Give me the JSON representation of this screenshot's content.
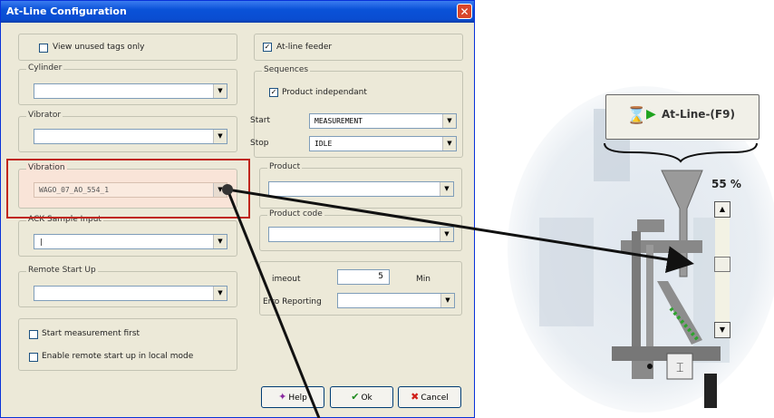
{
  "window": {
    "title": "At-Line Configuration",
    "close_glyph": "✕"
  },
  "left": {
    "view_unused": {
      "label": "View unused tags only",
      "checked": false
    },
    "cylinder": {
      "title": "Cylinder",
      "value": ""
    },
    "vibrator": {
      "title": "Vibrator",
      "value": ""
    },
    "vibration": {
      "title": "Vibration",
      "value": "WAGO_07_AO_554_1"
    },
    "ack": {
      "title": "ACK Sample Input",
      "value": "|"
    },
    "remote": {
      "title": "Remote Start Up",
      "value": ""
    },
    "start_first": {
      "label": "Start measurement first",
      "checked": false
    },
    "remote_local": {
      "label": "Enable remote start up in local mode",
      "checked": false
    }
  },
  "right": {
    "atline_feeder": {
      "label": "At-line feeder",
      "checked": true
    },
    "sequences": {
      "title": "Sequences",
      "product_independant": {
        "label": "Product independant",
        "checked": true
      },
      "start_label": "Start",
      "start_value": "MEASUREMENT",
      "stop_label": "Stop",
      "stop_value": "IDLE"
    },
    "product": {
      "title": "Product",
      "value": ""
    },
    "product_code": {
      "title": "Product code",
      "value": ""
    },
    "timeout": {
      "label": "imeout",
      "value": "5",
      "unit": "Min"
    },
    "error_reporting": {
      "label": "Erro  Reporting",
      "value": ""
    }
  },
  "buttons": {
    "help": "Help",
    "ok": "Ok",
    "cancel": "Cancel"
  },
  "device": {
    "atline_label": "At-Line-(F9)",
    "percent": "55 %",
    "fill_level_percent": 55
  },
  "colors": {
    "highlight": "#c0261d",
    "title_bar": "#0a52d8",
    "arrow": "#111111"
  }
}
